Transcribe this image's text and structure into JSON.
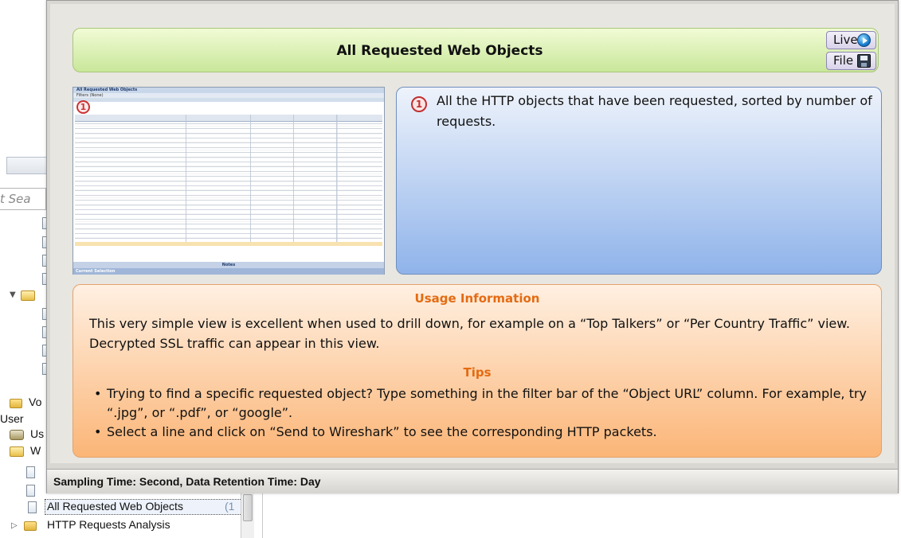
{
  "tree": {
    "search_placeholder": "t Sea",
    "partial_labels": {
      "vo": "Vo",
      "user": "User",
      "us": "Us",
      "w": "W"
    },
    "selected_item": "All Requested Web Objects",
    "selected_item_suffix": "(1",
    "next_item": "HTTP Requests Analysis"
  },
  "popup": {
    "title": "All Requested Web Objects",
    "live_button": "Live",
    "file_button": "File",
    "thumbnail": {
      "window_title": "All Requested Web Objects",
      "filter_label": "Filters (None)",
      "notes_label": "Notes",
      "status_label": "Current Selection"
    },
    "description": {
      "badge": "1",
      "text": "All the HTTP objects that have been requested, sorted by number of requests."
    },
    "usage": {
      "title": "Usage Information",
      "text": "This very simple view is excellent when used to drill down, for example on a “Top Talkers” or “Per Country Traffic” view. Decrypted SSL traffic can appear in this view.",
      "tips_title": "Tips",
      "tips": [
        "Trying to find a specific requested object? Type something in the filter bar of the “Object URL” column. For example, try “.jpg”, or “.pdf”, or “google”.",
        "Select a line and click on “Send to Wireshark” to see the corresponding HTTP packets."
      ]
    },
    "status": "Sampling Time: Second, Data Retention Time: Day"
  }
}
